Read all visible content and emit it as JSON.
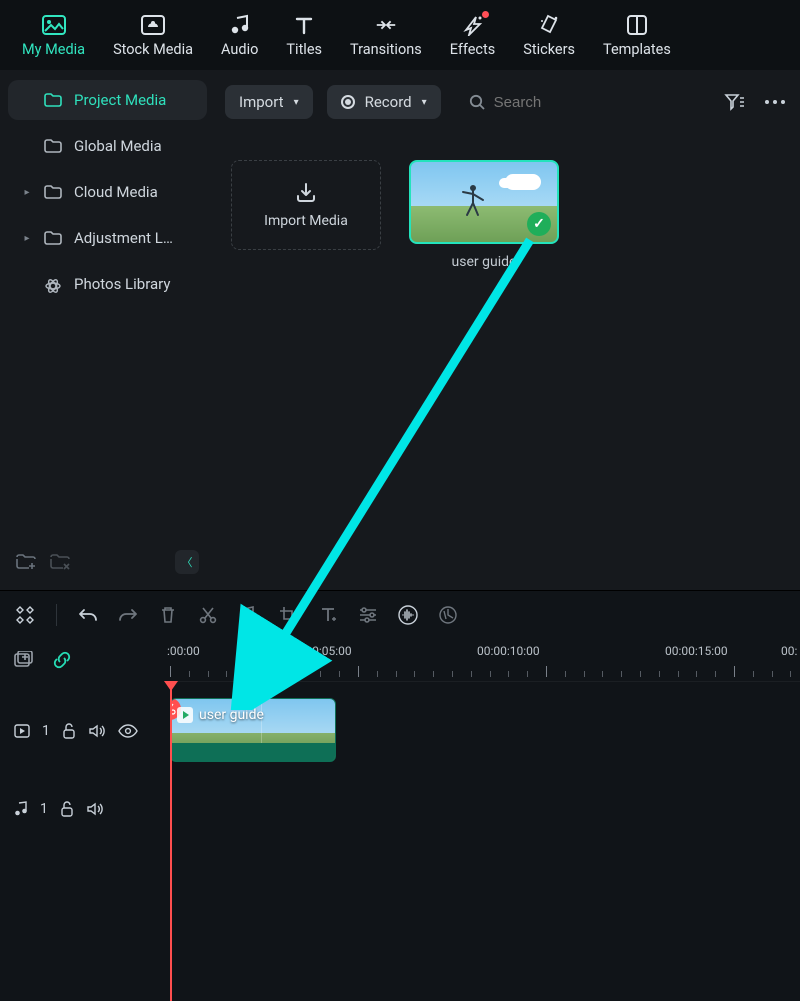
{
  "tabs": {
    "my_media": "My Media",
    "stock_media": "Stock Media",
    "audio": "Audio",
    "titles": "Titles",
    "transitions": "Transitions",
    "effects": "Effects",
    "stickers": "Stickers",
    "templates": "Templates"
  },
  "sidebar": {
    "project_media": "Project Media",
    "global_media": "Global Media",
    "cloud_media": "Cloud Media",
    "adjustment": "Adjustment L…",
    "photos_library": "Photos Library"
  },
  "toolbar": {
    "import": "Import",
    "record": "Record",
    "search_placeholder": "Search"
  },
  "media": {
    "import_card": "Import Media",
    "clip_name": "user guide"
  },
  "timeline": {
    "ruler": {
      "t0": ":00:00",
      "t1": "00:00:05:00",
      "t2": "00:00:10:00",
      "t3": "00:00:15:00",
      "t4": "00:"
    },
    "video_track_index": "1",
    "audio_track_index": "1",
    "clip_label": "user guide"
  }
}
